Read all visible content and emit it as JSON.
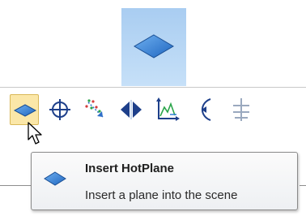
{
  "preview": {
    "icon": "plane-icon"
  },
  "toolbar": {
    "buttons": [
      {
        "icon": "plane-icon",
        "active": true
      },
      {
        "icon": "crosshair-icon",
        "active": false
      },
      {
        "icon": "scatter-arrow-icon",
        "active": false
      },
      {
        "icon": "mirror-icon",
        "active": false
      },
      {
        "icon": "chart-axes-icon",
        "active": false
      },
      {
        "icon": "arc-point-icon",
        "active": false
      },
      {
        "icon": "sliders-icon",
        "active": false
      }
    ]
  },
  "tooltip": {
    "icon": "plane-icon",
    "title": "Insert HotPlane",
    "description": "Insert a plane into the scene"
  },
  "colors": {
    "accent_blue": "#2f7fd6",
    "active_button_bg": "#fbe7a8",
    "preview_bg": "#b7d6f4"
  }
}
